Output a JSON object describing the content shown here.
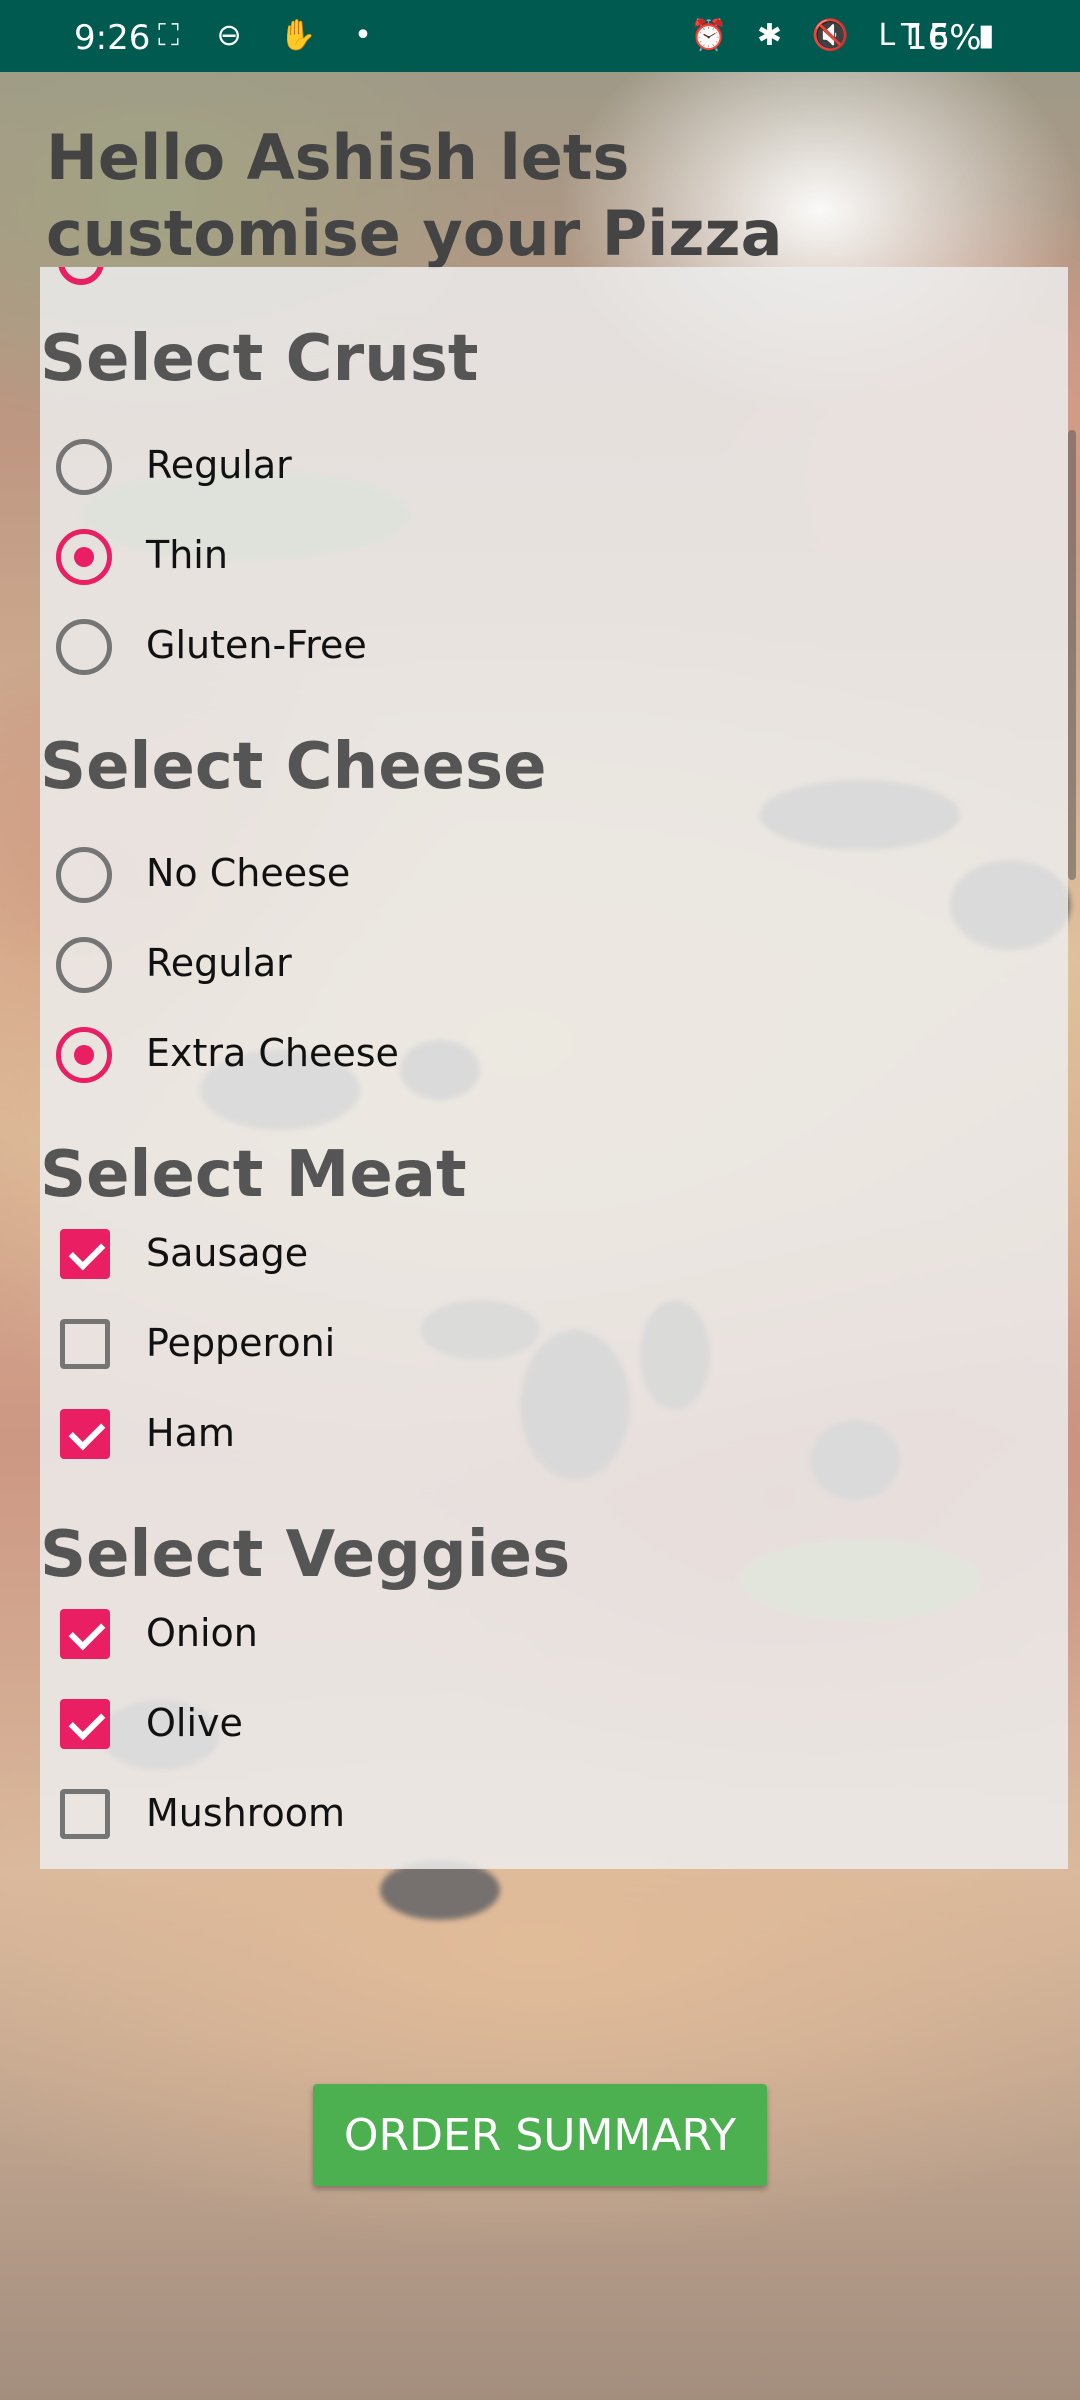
{
  "status_bar": {
    "time": "9:26",
    "left_icons": "⛶ ⊖ ✋ •",
    "right_icons": "⏰ ✱ 🔇 LTE ▮",
    "battery": "16%"
  },
  "greeting": "Hello Ashish lets customise your Pizza",
  "sections": {
    "crust": {
      "title": "Select Crust",
      "options": [
        {
          "label": "Regular",
          "checked": false
        },
        {
          "label": "Thin",
          "checked": true
        },
        {
          "label": "Gluten-Free",
          "checked": false
        }
      ]
    },
    "cheese": {
      "title": "Select Cheese",
      "options": [
        {
          "label": "No Cheese",
          "checked": false
        },
        {
          "label": "Regular",
          "checked": false
        },
        {
          "label": "Extra Cheese",
          "checked": true
        }
      ]
    },
    "meat": {
      "title": "Select Meat",
      "options": [
        {
          "label": "Sausage",
          "checked": true
        },
        {
          "label": "Pepperoni",
          "checked": false
        },
        {
          "label": "Ham",
          "checked": true
        }
      ]
    },
    "veggies": {
      "title": "Select Veggies",
      "options": [
        {
          "label": "Onion",
          "checked": true
        },
        {
          "label": "Olive",
          "checked": true
        },
        {
          "label": "Mushroom",
          "checked": false
        }
      ]
    }
  },
  "order_button_label": "ORDER SUMMARY",
  "colors": {
    "accent": "#e91e63",
    "button": "#4caf50",
    "status_bar": "#005a4f"
  }
}
